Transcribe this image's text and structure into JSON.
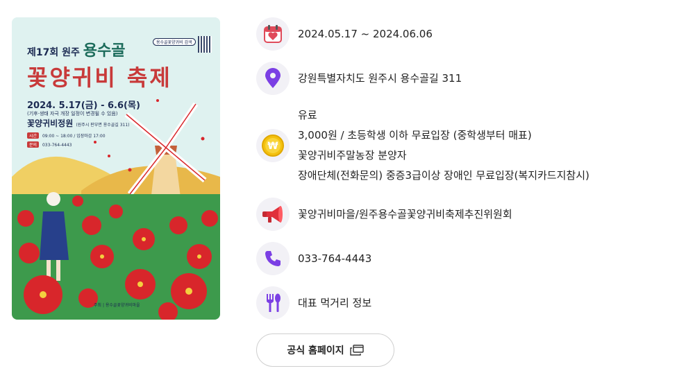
{
  "poster": {
    "edition": "제17회",
    "city": "원주",
    "title_a": "용수골",
    "title_b": "꽃양귀비 축제",
    "dates": "2024. 5.17(금) - 6.6(목)",
    "note": "(기후·생태 자극 개장 일정이 변경될 수 있음)",
    "venue": "꽃양귀비정원",
    "venue_addr": "(원주시 판부면 용수골길 311)",
    "time_label": "시간",
    "time": "09:00 ~ 18:00 / 입장마감 17:00",
    "phone_label": "문의",
    "phone": "033-764-4443",
    "search": "용수골꽃양귀비 검색",
    "organizer": "주최 | 용수골꽃양귀비마을"
  },
  "info": {
    "date": "2024.05.17 ~ 2024.06.06",
    "address": "강원특별자치도 원주시 용수골길 311",
    "fee_lines": [
      "유료",
      "3,000원 / 초등학생 이하 무료입장 (중학생부터 매표)",
      "꽃양귀비주말농장 분양자",
      "장애단체(전화문의) 중증3급이상 장애인 무료입장(복지카드지참시)"
    ],
    "host": "꽃양귀비마을/원주용수골꽃양귀비축제추진위원회",
    "tel": "033-764-4443",
    "food": "대표 먹거리 정보"
  },
  "homepage_button": "공식 홈페이지",
  "colors": {
    "accent": "#7b3fe4",
    "icon_bg": "#f2f1f6",
    "poppy": "#d8262b"
  },
  "icons": [
    "calendar-heart-icon",
    "location-pin-icon",
    "won-coin-icon",
    "megaphone-icon",
    "phone-icon",
    "fork-spoon-icon",
    "external-window-icon"
  ]
}
